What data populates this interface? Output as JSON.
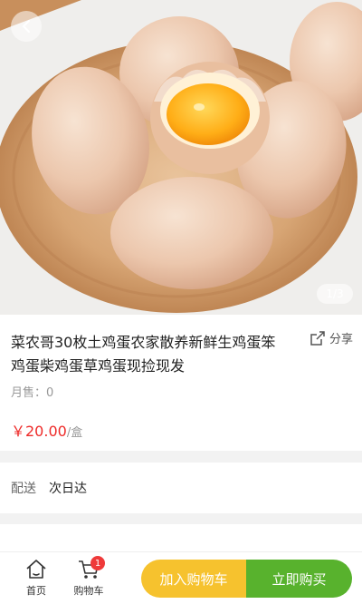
{
  "hero": {
    "counter": "1/3"
  },
  "product": {
    "title": "菜农哥30枚土鸡蛋农家散养新鲜生鸡蛋笨鸡蛋柴鸡蛋草鸡蛋现捡现发",
    "share_label": "分享",
    "sales_label": "月售：",
    "sales_value": "0",
    "price": "￥20.00",
    "unit": "/盒"
  },
  "delivery": {
    "label": "配送",
    "value": "次日达"
  },
  "bottombar": {
    "home_label": "首页",
    "cart_label": "购物车",
    "cart_badge": "1",
    "add_to_cart_label": "加入购物车",
    "buy_now_label": "立即购买"
  },
  "colors": {
    "price": "#ee2a28",
    "add_to_cart": "#f6c22e",
    "buy_now": "#58b22d",
    "badge": "#ef3a3a"
  }
}
